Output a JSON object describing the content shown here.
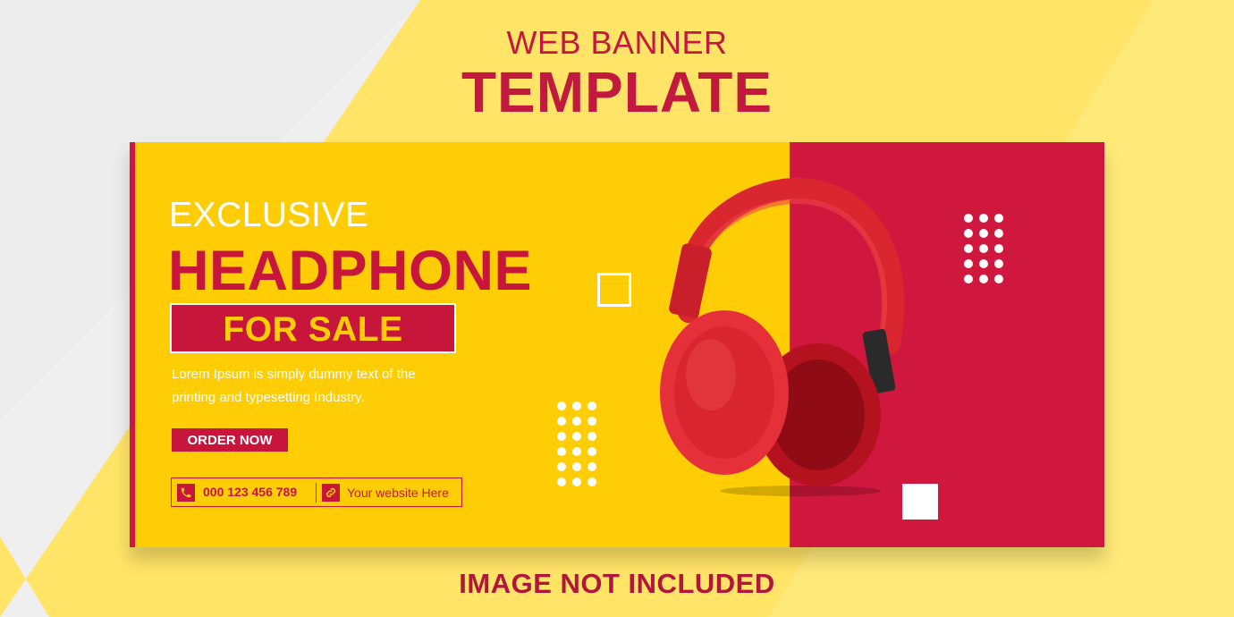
{
  "header": {
    "subtitle": "WEB BANNER",
    "title": "TEMPLATE"
  },
  "banner": {
    "eyebrow": "EXCLUSIVE",
    "headline": "HEADPHONE",
    "tagline": "FOR SALE",
    "body_line1": "Lorem Ipsum is simply dummy text of the",
    "body_line2": "printing and typesetting Industry.",
    "cta_label": "ORDER NOW",
    "phone": "000 123 456 789",
    "website": "Your website Here"
  },
  "footer": {
    "note": "IMAGE NOT INCLUDED"
  },
  "icons": [
    "phone-icon",
    "link-icon",
    "headphones-image"
  ],
  "colors": {
    "brand_red": "#c8153c",
    "brand_yellow": "#ffcd05",
    "white": "#ffffff"
  }
}
